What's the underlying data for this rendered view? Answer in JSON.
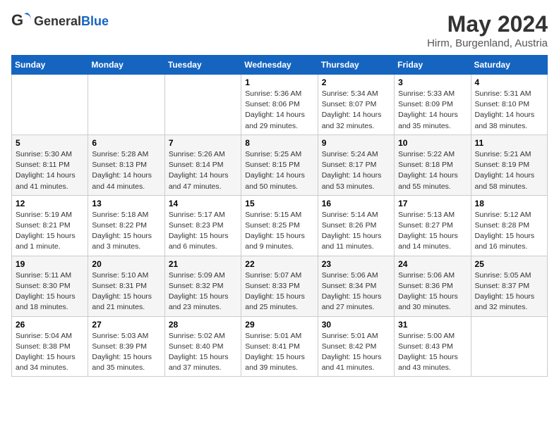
{
  "header": {
    "logo_general": "General",
    "logo_blue": "Blue",
    "title": "May 2024",
    "subtitle": "Hirm, Burgenland, Austria"
  },
  "calendar": {
    "weekdays": [
      "Sunday",
      "Monday",
      "Tuesday",
      "Wednesday",
      "Thursday",
      "Friday",
      "Saturday"
    ],
    "weeks": [
      [
        {
          "day": "",
          "info": ""
        },
        {
          "day": "",
          "info": ""
        },
        {
          "day": "",
          "info": ""
        },
        {
          "day": "1",
          "info": "Sunrise: 5:36 AM\nSunset: 8:06 PM\nDaylight: 14 hours\nand 29 minutes."
        },
        {
          "day": "2",
          "info": "Sunrise: 5:34 AM\nSunset: 8:07 PM\nDaylight: 14 hours\nand 32 minutes."
        },
        {
          "day": "3",
          "info": "Sunrise: 5:33 AM\nSunset: 8:09 PM\nDaylight: 14 hours\nand 35 minutes."
        },
        {
          "day": "4",
          "info": "Sunrise: 5:31 AM\nSunset: 8:10 PM\nDaylight: 14 hours\nand 38 minutes."
        }
      ],
      [
        {
          "day": "5",
          "info": "Sunrise: 5:30 AM\nSunset: 8:11 PM\nDaylight: 14 hours\nand 41 minutes."
        },
        {
          "day": "6",
          "info": "Sunrise: 5:28 AM\nSunset: 8:13 PM\nDaylight: 14 hours\nand 44 minutes."
        },
        {
          "day": "7",
          "info": "Sunrise: 5:26 AM\nSunset: 8:14 PM\nDaylight: 14 hours\nand 47 minutes."
        },
        {
          "day": "8",
          "info": "Sunrise: 5:25 AM\nSunset: 8:15 PM\nDaylight: 14 hours\nand 50 minutes."
        },
        {
          "day": "9",
          "info": "Sunrise: 5:24 AM\nSunset: 8:17 PM\nDaylight: 14 hours\nand 53 minutes."
        },
        {
          "day": "10",
          "info": "Sunrise: 5:22 AM\nSunset: 8:18 PM\nDaylight: 14 hours\nand 55 minutes."
        },
        {
          "day": "11",
          "info": "Sunrise: 5:21 AM\nSunset: 8:19 PM\nDaylight: 14 hours\nand 58 minutes."
        }
      ],
      [
        {
          "day": "12",
          "info": "Sunrise: 5:19 AM\nSunset: 8:21 PM\nDaylight: 15 hours\nand 1 minute."
        },
        {
          "day": "13",
          "info": "Sunrise: 5:18 AM\nSunset: 8:22 PM\nDaylight: 15 hours\nand 3 minutes."
        },
        {
          "day": "14",
          "info": "Sunrise: 5:17 AM\nSunset: 8:23 PM\nDaylight: 15 hours\nand 6 minutes."
        },
        {
          "day": "15",
          "info": "Sunrise: 5:15 AM\nSunset: 8:25 PM\nDaylight: 15 hours\nand 9 minutes."
        },
        {
          "day": "16",
          "info": "Sunrise: 5:14 AM\nSunset: 8:26 PM\nDaylight: 15 hours\nand 11 minutes."
        },
        {
          "day": "17",
          "info": "Sunrise: 5:13 AM\nSunset: 8:27 PM\nDaylight: 15 hours\nand 14 minutes."
        },
        {
          "day": "18",
          "info": "Sunrise: 5:12 AM\nSunset: 8:28 PM\nDaylight: 15 hours\nand 16 minutes."
        }
      ],
      [
        {
          "day": "19",
          "info": "Sunrise: 5:11 AM\nSunset: 8:30 PM\nDaylight: 15 hours\nand 18 minutes."
        },
        {
          "day": "20",
          "info": "Sunrise: 5:10 AM\nSunset: 8:31 PM\nDaylight: 15 hours\nand 21 minutes."
        },
        {
          "day": "21",
          "info": "Sunrise: 5:09 AM\nSunset: 8:32 PM\nDaylight: 15 hours\nand 23 minutes."
        },
        {
          "day": "22",
          "info": "Sunrise: 5:07 AM\nSunset: 8:33 PM\nDaylight: 15 hours\nand 25 minutes."
        },
        {
          "day": "23",
          "info": "Sunrise: 5:06 AM\nSunset: 8:34 PM\nDaylight: 15 hours\nand 27 minutes."
        },
        {
          "day": "24",
          "info": "Sunrise: 5:06 AM\nSunset: 8:36 PM\nDaylight: 15 hours\nand 30 minutes."
        },
        {
          "day": "25",
          "info": "Sunrise: 5:05 AM\nSunset: 8:37 PM\nDaylight: 15 hours\nand 32 minutes."
        }
      ],
      [
        {
          "day": "26",
          "info": "Sunrise: 5:04 AM\nSunset: 8:38 PM\nDaylight: 15 hours\nand 34 minutes."
        },
        {
          "day": "27",
          "info": "Sunrise: 5:03 AM\nSunset: 8:39 PM\nDaylight: 15 hours\nand 35 minutes."
        },
        {
          "day": "28",
          "info": "Sunrise: 5:02 AM\nSunset: 8:40 PM\nDaylight: 15 hours\nand 37 minutes."
        },
        {
          "day": "29",
          "info": "Sunrise: 5:01 AM\nSunset: 8:41 PM\nDaylight: 15 hours\nand 39 minutes."
        },
        {
          "day": "30",
          "info": "Sunrise: 5:01 AM\nSunset: 8:42 PM\nDaylight: 15 hours\nand 41 minutes."
        },
        {
          "day": "31",
          "info": "Sunrise: 5:00 AM\nSunset: 8:43 PM\nDaylight: 15 hours\nand 43 minutes."
        },
        {
          "day": "",
          "info": ""
        }
      ]
    ]
  }
}
